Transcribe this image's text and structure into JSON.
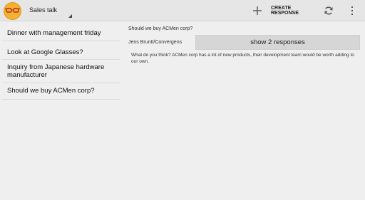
{
  "actionbar": {
    "app_icon": "glasses-icon",
    "nav_title": "Sales talk",
    "add_icon": "plus-icon",
    "create_label": "CREATE RESPONSE",
    "refresh_icon": "refresh-icon",
    "overflow_icon": "overflow-menu-icon"
  },
  "list": {
    "items": [
      {
        "title": "Dinner with management friday"
      },
      {
        "title": "Look at Google Glasses?"
      },
      {
        "title": "Inquiry from Japanese hardware manufacturer"
      },
      {
        "title": "Should we buy ACMen corp?"
      }
    ]
  },
  "detail": {
    "subject": "Should we buy ACMen corp?",
    "sender": "Jens Bruntt/Convergens",
    "show_button_label": "show 2 responses",
    "body": "What do you think? ACMen corp has a lot of new products, their development team would be worth adding to our own."
  },
  "colors": {
    "background": "#efefef",
    "actionbar": "#e6e6e6",
    "button": "#d6d6d6",
    "icon_orange": "#f0a020"
  }
}
